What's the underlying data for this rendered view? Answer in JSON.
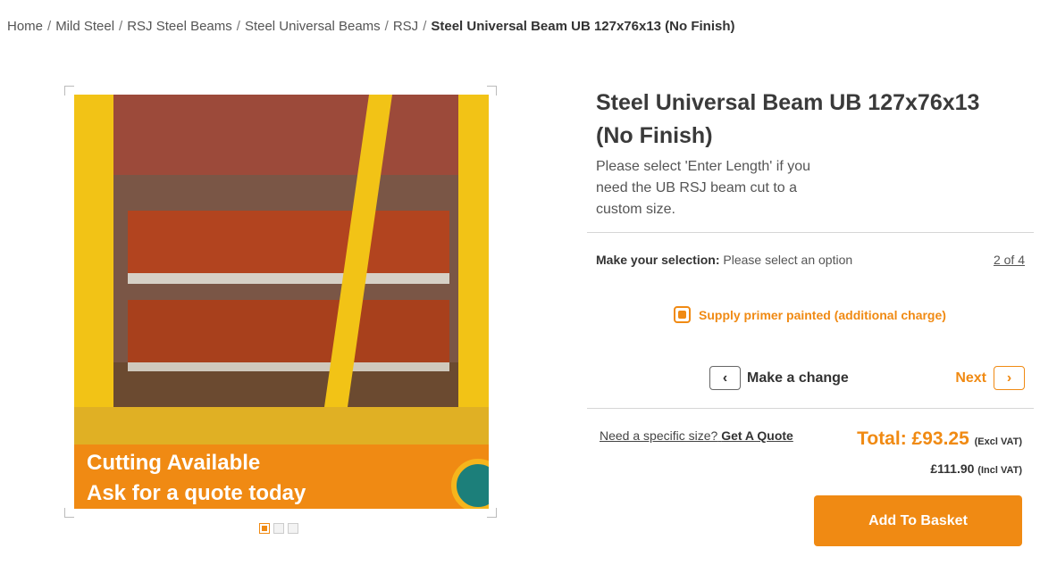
{
  "breadcrumb": {
    "items": [
      "Home",
      "Mild Steel",
      "RSJ Steel Beams",
      "Steel Universal Beams",
      "RSJ"
    ],
    "current": "Steel Universal Beam UB 127x76x13 (No Finish)",
    "separator": "/"
  },
  "gallery": {
    "banner_line1": "Cutting Available",
    "banner_line2": "Ask for a quote today",
    "dots_total": 3,
    "dots_active": 1
  },
  "product": {
    "title": "Steel Universal Beam UB 127x76x13 (No Finish)",
    "subtitle": "Please select 'Enter Length' if you need the UB RSJ beam cut to a custom size."
  },
  "selection": {
    "label": "Make your selection:",
    "value": "Please select an option",
    "step": "2 of 4"
  },
  "option": {
    "label": "Supply primer painted (additional charge)",
    "checked": true
  },
  "navigation": {
    "change_label": "Make a change",
    "next_label": "Next"
  },
  "pricing": {
    "quote_prefix": "Need a specific size?",
    "quote_link": "Get A Quote",
    "total": "Total: £93.25",
    "excl_vat": "(Excl VAT)",
    "incl_price": "£111.90",
    "incl_vat": "(Incl VAT)"
  },
  "actions": {
    "add_to_basket": "Add To Basket"
  },
  "colors": {
    "accent": "#f08a13"
  }
}
